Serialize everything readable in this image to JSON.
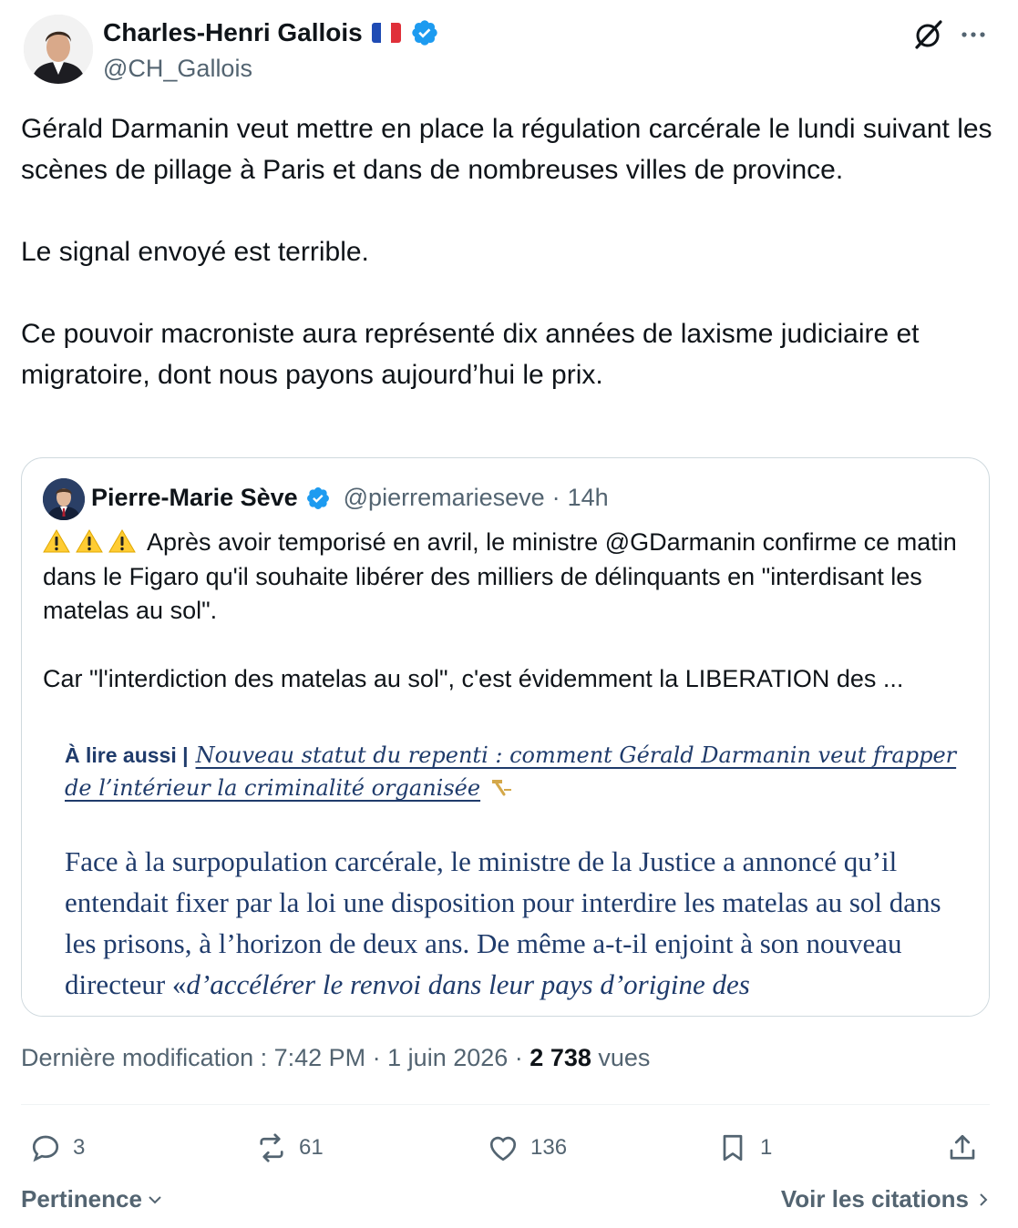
{
  "author": {
    "name": "Charles-Henri Gallois",
    "handle": "@CH_Gallois",
    "flag_icon": "france-flag-icon",
    "verified": true,
    "verified_color": "#1d9bf0"
  },
  "tweet": {
    "paragraphs": [
      "Gérald Darmanin veut mettre en place la régulation carcérale le lundi suivant les scènes de pillage à Paris et dans de nombreuses villes de province.",
      "Le signal envoyé est terrible.",
      "Ce pouvoir macroniste aura représenté dix années de laxisme judiciaire et migratoire, dont nous payons aujourd’hui le prix."
    ]
  },
  "quote": {
    "name": "Pierre-Marie Sève",
    "handle": "@pierremarieseve",
    "separator": "·",
    "time": "14h",
    "paragraph1": "Après avoir temporisé en avril, le ministre @GDarmanin confirme ce matin dans le Figaro qu'il souhaite libérer des milliers de délinquants en \"interdisant les matelas au sol\".",
    "paragraph2": "Car \"l'interdiction des matelas au sol\", c'est évidemment la LIBERATION des ...",
    "image": {
      "lire_label": "À lire aussi |",
      "lire_link": "Nouveau statut du repenti : comment Gérald Darmanin veut frapper de l’intérieur la criminalité organisée",
      "article_plain": "Face à la surpopulation carcérale, le ministre de la Justice a annoncé qu’il entendait fixer par la loi une disposition pour interdire les matelas au sol dans les prisons, à l’horizon de deux ans. De même a-t-il enjoint à son nouveau directeur «",
      "article_italic": "d’accélérer le renvoi dans leur pays d’origine des"
    }
  },
  "meta": {
    "last_modified": "Dernière modification : 7:42 PM · 1 juin 2026 ·",
    "views_count": "2 738",
    "views_label": "vues"
  },
  "actions": {
    "replies": "3",
    "reposts": "61",
    "likes": "136",
    "bookmarks": "1"
  },
  "footer": {
    "sort_label": "Pertinence",
    "quotes_label": "Voir les citations"
  },
  "colors": {
    "text": "#0f1419",
    "secondary": "#536471",
    "border": "#cfd9de",
    "article_blue": "#1f3b6b"
  }
}
